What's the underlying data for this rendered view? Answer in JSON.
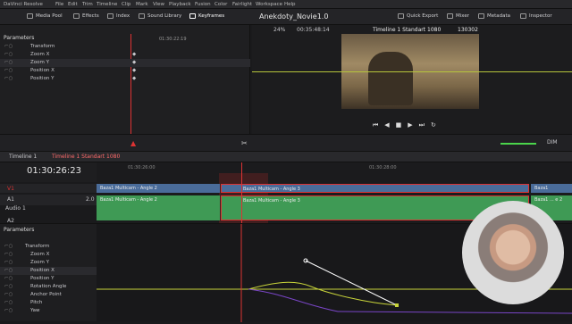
{
  "titlebar": {
    "app_menu": "DaVinci Resolve",
    "menus": [
      "File",
      "Edit",
      "Trim",
      "Timeline",
      "Clip",
      "Mark",
      "View",
      "Playback",
      "Fusion",
      "Color",
      "Fairlight",
      "Workspace",
      "Help"
    ]
  },
  "toolbar": {
    "media_pool": "Media Pool",
    "effects": "Effects",
    "index": "Index",
    "sound_library": "Sound Library",
    "keyframes": "Keyframes",
    "project": "Anekdoty_Novie1.0",
    "quick_export": "Quick Export",
    "mixer": "Mixer",
    "metadata": "Metadata",
    "inspector": "Inspector"
  },
  "inspector": {
    "header": "Parameters",
    "rows": [
      {
        "label": "Transform",
        "color": "#888"
      },
      {
        "label": "Zoom X",
        "color": "#d14fd1"
      },
      {
        "label": "Zoom Y",
        "color": "#8a62ff"
      },
      {
        "label": "Position X",
        "color": "#d84a4a"
      },
      {
        "label": "Position Y",
        "color": "#5a8ee8"
      }
    ],
    "ruler_tc": "01:30:22:19"
  },
  "viewer": {
    "zoom": "24%",
    "timecode": "00:35:48:14",
    "timeline_name": "Timeline 1 Standart 1080",
    "frame": "130302"
  },
  "timeline": {
    "tabs": [
      "Timeline 1",
      "Timeline 1 Standart 1080"
    ],
    "timecode": "01:30:26:23",
    "ruler_left": "01:30:26:00",
    "ruler_right": "01:30:28:00",
    "audio_level": "DIM"
  },
  "tracks": {
    "v1": {
      "name": "V1",
      "clips": [
        {
          "label": "Baza1 Multicam - Angle 2"
        },
        {
          "label": "Baza1 Multicam - Angle 3"
        },
        {
          "label": "Baza1"
        }
      ]
    },
    "a1": {
      "name": "A1",
      "sub": "Audio 1",
      "value": "2.0",
      "clips": [
        {
          "label": "Baza1 Multicam - Angle 2"
        },
        {
          "label": "Baza1 Multicam - Angle 3"
        },
        {
          "label": "Baza1 ... e 2"
        }
      ]
    },
    "a2": {
      "name": "A2"
    }
  },
  "curve_params": {
    "header": "Parameters",
    "rows": [
      "Transform",
      "Zoom X",
      "Zoom Y",
      "Position X",
      "Position Y",
      "Rotation Angle",
      "Anchor Point",
      "Pitch",
      "Yaw"
    ],
    "colors": [
      "#888",
      "#d14fd1",
      "#8a62ff",
      "#d84a4a",
      "#5a8ee8",
      "#e0a040",
      "#60c060",
      "#c0c060",
      "#60c0c0"
    ]
  }
}
